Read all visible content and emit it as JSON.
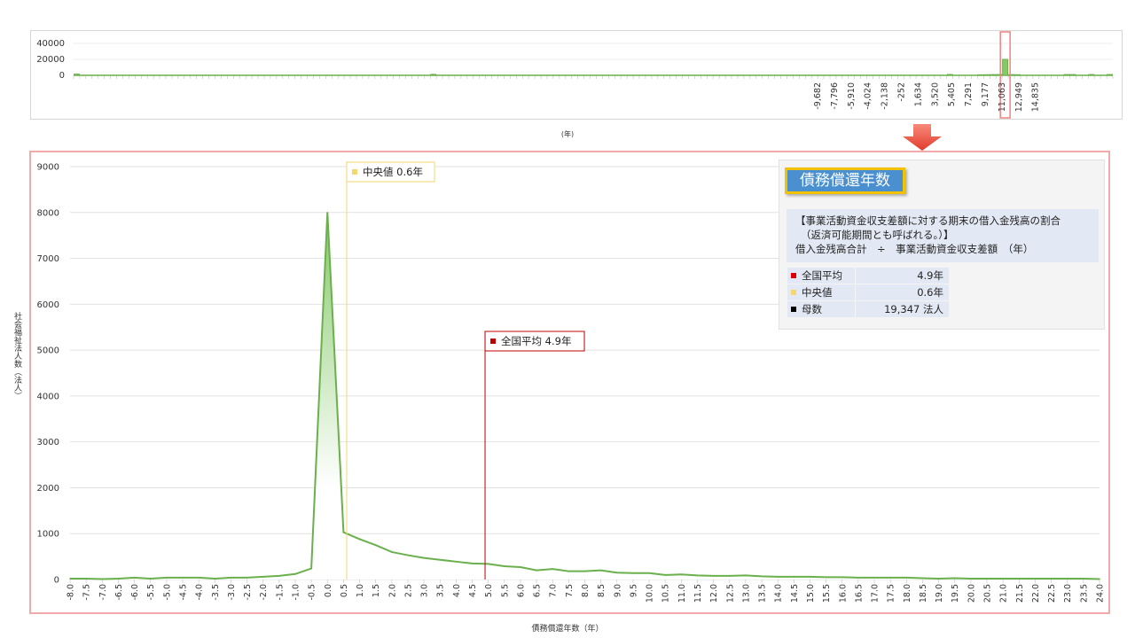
{
  "overview": {
    "y_ticks": [
      "40000",
      "20000",
      "0"
    ],
    "x_tick_labels": [
      "-9,682",
      "-7,796",
      "-5,910",
      "-4,024",
      "-2,138",
      "-252",
      "1,634",
      "3,520",
      "5,405",
      "7,291",
      "9,177",
      "11,063",
      "12,949",
      "14,835"
    ],
    "x_unit": "(年)",
    "highlight_color": "#f08080"
  },
  "colors": {
    "line": "#6ab04c",
    "fill_top": "#86c96a",
    "fill_bottom": "#ffffff",
    "mean": "#c00000",
    "median": "#f5d76e",
    "panel_border": "#f2a9a9",
    "title_bg": "#4a8fd0",
    "title_border": "#f2c200"
  },
  "chart_data": [
    {
      "type": "bar",
      "ylim": [
        0,
        40000
      ],
      "note": "overview histogram of full range",
      "values": [
        1500,
        0,
        0,
        0,
        0,
        0,
        0,
        0,
        0,
        0,
        0,
        0,
        0,
        0,
        0,
        0,
        0,
        0,
        0,
        0,
        0,
        0,
        0,
        0,
        0,
        0,
        0,
        0,
        0,
        0,
        0,
        0,
        0,
        0,
        0,
        0,
        0,
        0,
        0,
        0,
        0,
        0,
        0,
        0,
        0,
        0,
        0,
        0,
        0,
        0,
        0,
        0,
        0,
        0,
        0,
        0,
        0,
        0,
        1200,
        0,
        0,
        0,
        0,
        0,
        0,
        0,
        0,
        0,
        0,
        0,
        0,
        0,
        0,
        0,
        0,
        0,
        0,
        0,
        0,
        0,
        0,
        0,
        0,
        0,
        0,
        0,
        0,
        0,
        0,
        0,
        0,
        0,
        0,
        0,
        0,
        0,
        0,
        0,
        0,
        0,
        0,
        0,
        0,
        0,
        0,
        0,
        0,
        0,
        0,
        0,
        0,
        0,
        0,
        0,
        0,
        0,
        0,
        0,
        0,
        0,
        0,
        0,
        0,
        0,
        0,
        0,
        0,
        0,
        0,
        0,
        0,
        0,
        0,
        0,
        0,
        0,
        0,
        0,
        0,
        0,
        0,
        0,
        1100,
        0,
        0,
        0,
        0,
        700,
        800,
        900,
        1000,
        20000,
        900,
        800,
        0,
        0,
        0,
        0,
        0,
        0,
        0,
        1000,
        1000,
        0,
        0,
        1000,
        0,
        0,
        1000
      ]
    },
    {
      "type": "area",
      "title": "",
      "xlabel": "債務償還年数（年）",
      "ylabel": "社会福祉法人数（法人）",
      "ylim": [
        0,
        9000
      ],
      "yticks": [
        0,
        1000,
        2000,
        3000,
        4000,
        5000,
        6000,
        7000,
        8000,
        9000
      ],
      "xlim": [
        -8.0,
        24.0
      ],
      "x_tick_step": 0.5,
      "grid": true,
      "x": [
        -8.0,
        -7.5,
        -7.0,
        -6.5,
        -6.0,
        -5.5,
        -5.0,
        -4.5,
        -4.0,
        -3.5,
        -3.0,
        -2.5,
        -2.0,
        -1.5,
        -1.0,
        -0.5,
        0.0,
        0.5,
        1.0,
        1.5,
        2.0,
        2.5,
        3.0,
        3.5,
        4.0,
        4.5,
        5.0,
        5.5,
        6.0,
        6.5,
        7.0,
        7.5,
        8.0,
        8.5,
        9.0,
        9.5,
        10.0,
        10.5,
        11.0,
        11.5,
        12.0,
        12.5,
        13.0,
        13.5,
        14.0,
        14.5,
        15.0,
        15.5,
        16.0,
        16.5,
        17.0,
        17.5,
        18.0,
        18.5,
        19.0,
        19.5,
        20.0,
        20.5,
        21.0,
        21.5,
        22.0,
        22.5,
        23.0,
        23.5,
        24.0
      ],
      "y": [
        20,
        20,
        10,
        20,
        40,
        20,
        40,
        40,
        40,
        20,
        40,
        40,
        60,
        80,
        120,
        240,
        8000,
        1030,
        880,
        750,
        600,
        530,
        470,
        430,
        390,
        350,
        340,
        290,
        270,
        200,
        230,
        180,
        180,
        200,
        150,
        140,
        140,
        100,
        110,
        90,
        80,
        80,
        90,
        70,
        60,
        60,
        60,
        50,
        50,
        40,
        40,
        40,
        40,
        30,
        20,
        30,
        20,
        20,
        20,
        20,
        20,
        20,
        20,
        20,
        10
      ],
      "annotations": [
        {
          "label": "中央値",
          "value": "0.6年",
          "x": 0.6
        },
        {
          "label": "全国平均",
          "value": "4.9年",
          "x": 4.9
        }
      ]
    }
  ],
  "info": {
    "title": "債務償還年数",
    "desc_line1": "【事業活動資金収支差額に対する期末の借入金残高の割合",
    "desc_line2": "（返済可能期間とも呼ばれる。）】",
    "desc_line3": "借入金残高合計　÷　事業活動資金収支差額　（年）",
    "stats": [
      {
        "label": "全国平均",
        "value": "4.9年",
        "color": "#e00000"
      },
      {
        "label": "中央値",
        "value": "0.6年",
        "color": "#f5d76e"
      },
      {
        "label": "母数",
        "value": "19,347  法人",
        "color": "#000000"
      }
    ]
  }
}
